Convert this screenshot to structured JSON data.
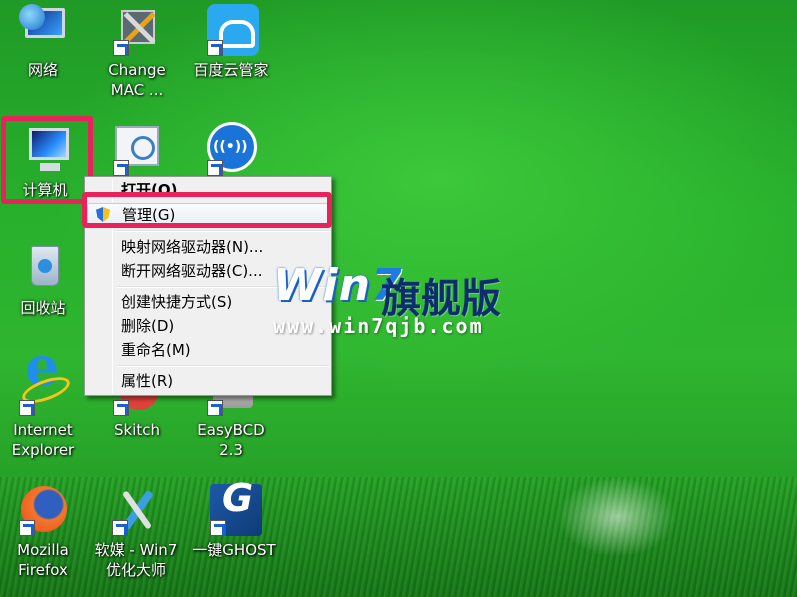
{
  "desktop": {
    "icons": [
      {
        "label": "网络"
      },
      {
        "label": "Change\nMAC ..."
      },
      {
        "label": "百度云管家"
      },
      {
        "label": "计算机"
      },
      {
        "label": ""
      },
      {
        "label": ""
      },
      {
        "label": "回收站"
      },
      {
        "label": "Internet\nExplorer"
      },
      {
        "label": "Skitch"
      },
      {
        "label": "EasyBCD\n2.3"
      },
      {
        "label": "Mozilla\nFirefox"
      },
      {
        "label": "软媒 - Win7\n优化大师"
      },
      {
        "label": "一键GHOST"
      }
    ]
  },
  "context_menu": {
    "items": [
      {
        "label": "打开(O)"
      },
      {
        "label": "管理(G)"
      },
      {
        "label": "映射网络驱动器(N)..."
      },
      {
        "label": "断开网络驱动器(C)..."
      },
      {
        "label": "创建快捷方式(S)"
      },
      {
        "label": "删除(D)"
      },
      {
        "label": "重命名(M)"
      },
      {
        "label": "属性(R)"
      }
    ]
  },
  "watermark": {
    "brand_win": "Win",
    "brand_seven": "7",
    "brand_cn": "旗舰版",
    "url": "www.win7qjb.com"
  },
  "colors": {
    "highlight": "#e8225a",
    "desktop_green": "#2fb52f"
  }
}
